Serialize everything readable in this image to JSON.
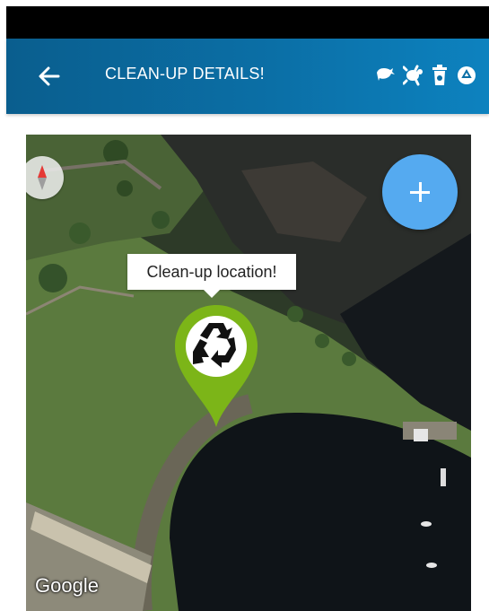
{
  "app_bar": {
    "title": "CLEAN-UP DETAILS!",
    "back_icon": "arrow-left-icon",
    "icons": [
      "whale-icon",
      "turtle-icon",
      "trash-bin-icon",
      "recycle-icon"
    ],
    "background_color": "#0b6fa6"
  },
  "map": {
    "info_window_text": "Clean-up location!",
    "marker_icon": "recycle-icon",
    "marker_color": "#7cb518",
    "fab_icon": "plus-icon",
    "fab_color": "#55aaf0",
    "compass_icon": "compass-icon",
    "attribution": "Google"
  }
}
